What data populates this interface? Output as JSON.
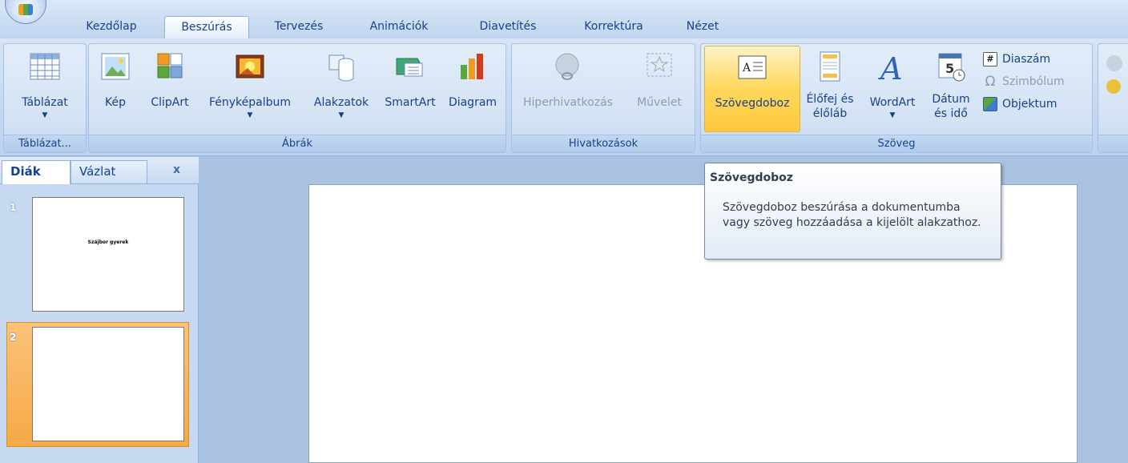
{
  "tabs": [
    "Kezdőlap",
    "Beszúrás",
    "Tervezés",
    "Animációk",
    "Diavetítés",
    "Korrektúra",
    "Nézet"
  ],
  "ribbon": {
    "groups": {
      "tablazat": {
        "label": "Táblázat...",
        "buttons": {
          "tablazat": "Táblázat"
        }
      },
      "abrak": {
        "label": "Ábrák",
        "buttons": {
          "kep": "Kép",
          "clipart": "ClipArt",
          "fenykepalbum": "Fényképalbum",
          "alakzatok": "Alakzatok",
          "smartart": "SmartArt",
          "diagram": "Diagram"
        }
      },
      "hivatkozasok": {
        "label": "Hivatkozások",
        "buttons": {
          "hiperhivatkozas": "Hiperhivatkozás",
          "muvelet": "Művelet"
        }
      },
      "szoveg": {
        "label": "Szöveg",
        "buttons": {
          "szovegdoboz": "Szövegdoboz",
          "elofej_line1": "Élőfej és",
          "elofej_line2": "élőláb",
          "wordart": "WordArt",
          "datum_line1": "Dátum",
          "datum_line2": "és idő",
          "diaszam": "Diaszám",
          "szimbolum": "Szimbólum",
          "objektum": "Objektum"
        }
      }
    }
  },
  "slide_panel": {
    "tabs": {
      "diak": "Diák",
      "vazlat": "Vázlat",
      "close": "x"
    },
    "slides": [
      {
        "number": "1",
        "thumb_text": "Szájbor gyerek"
      },
      {
        "number": "2",
        "thumb_text": ""
      }
    ]
  },
  "tooltip": {
    "title": "Szövegdoboz",
    "body": "Szövegdoboz beszúrása a dokumentumba vagy szöveg hozzáadása a kijelölt alakzathoz."
  },
  "colors": {
    "ribbon_blue": "#c2d7f0",
    "selected_orange": "#f5a946",
    "text_blue": "#15428b"
  }
}
